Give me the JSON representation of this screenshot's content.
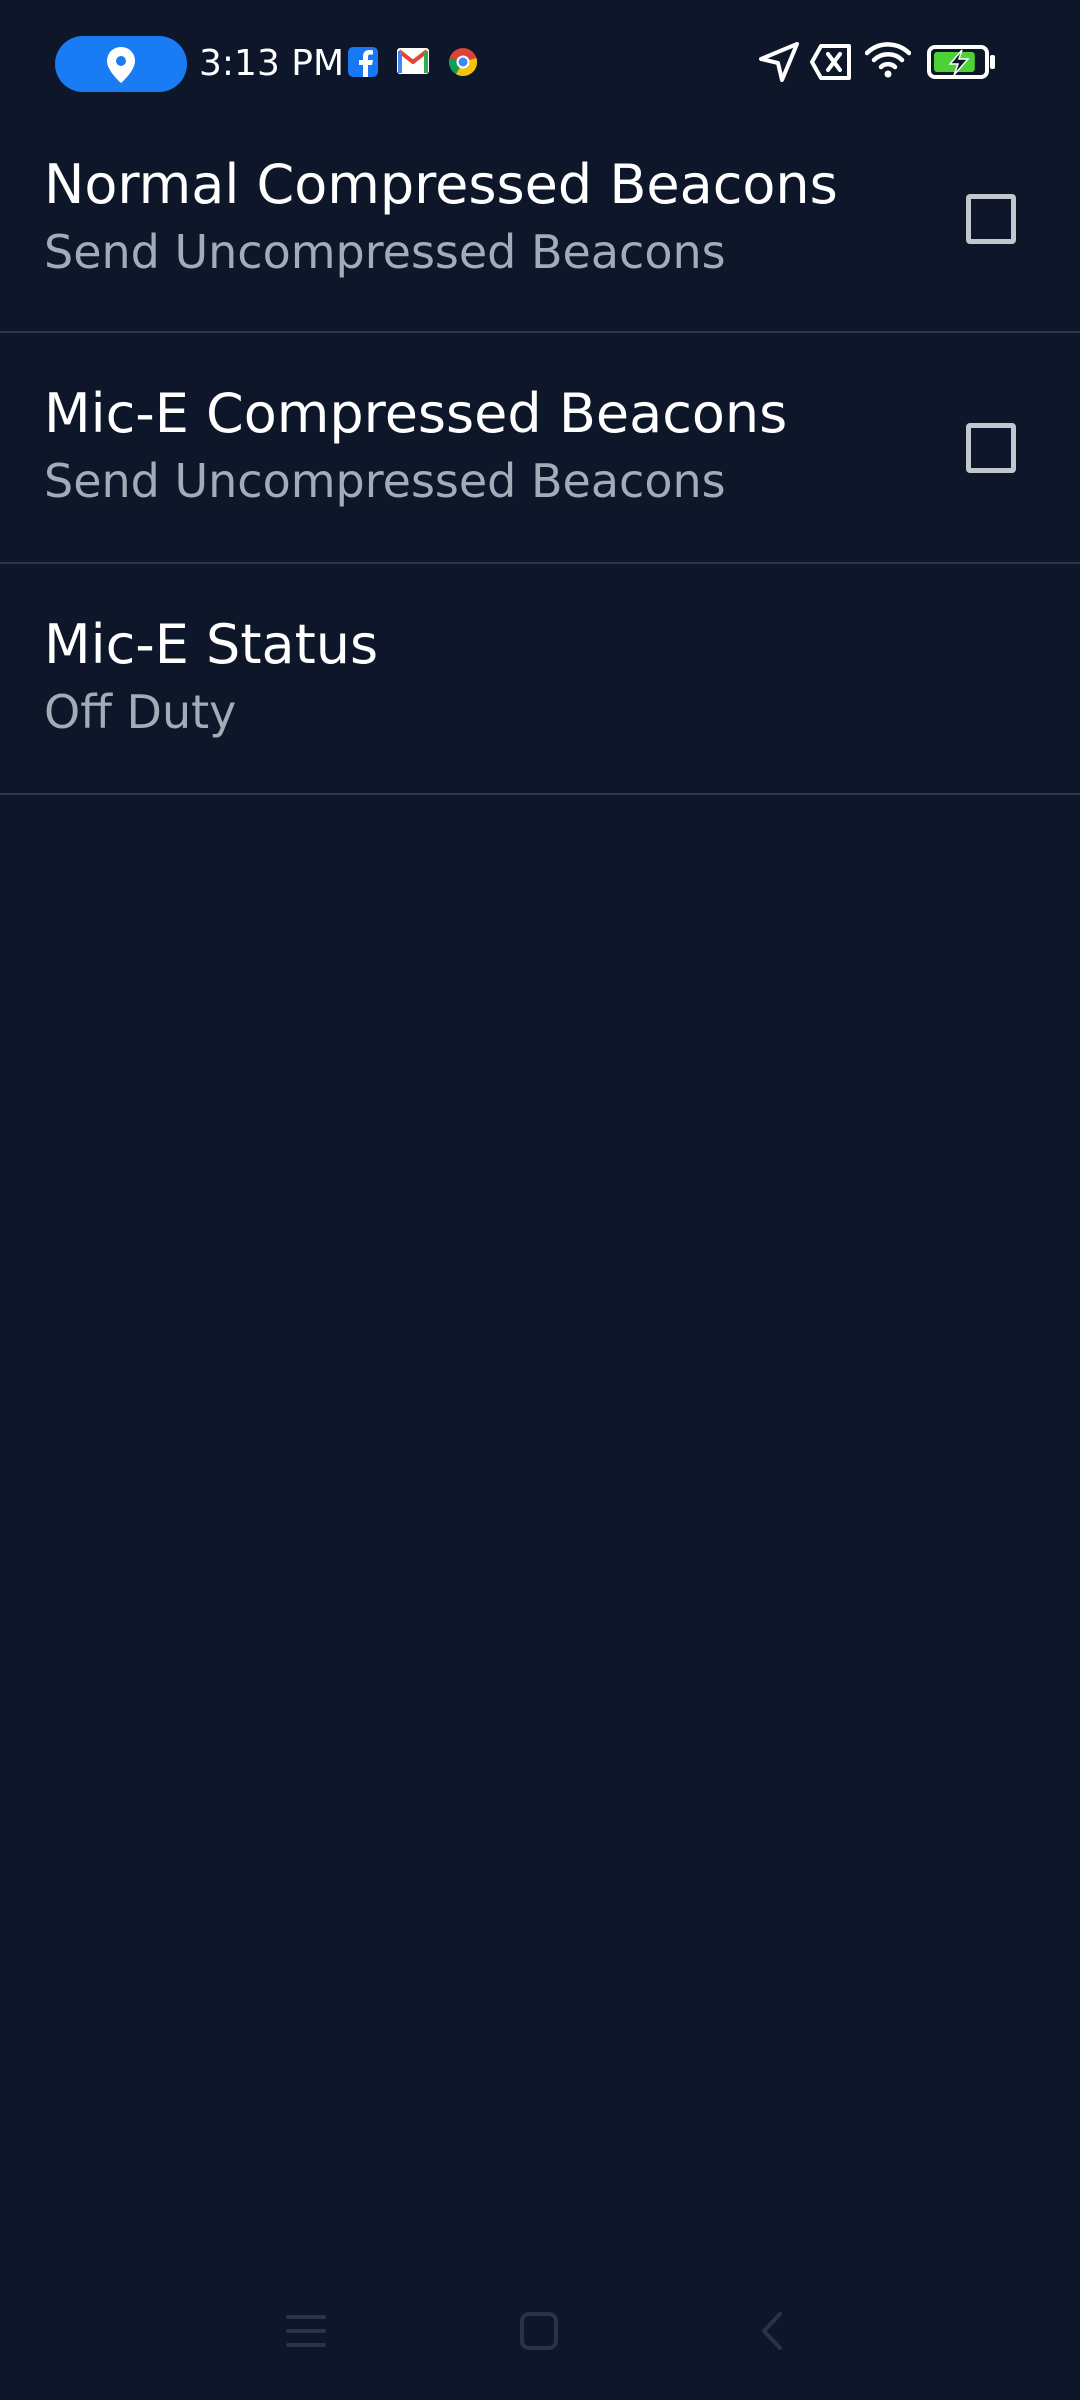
{
  "status_bar": {
    "time": "3:13 PM",
    "icons_left": [
      "location-pin-icon",
      "facebook-icon",
      "gmail-icon",
      "chrome-icon"
    ],
    "icons_right": [
      "navigation-arrow-icon",
      "no-sim-icon",
      "wifi-icon",
      "battery-charging-icon"
    ],
    "battery_fill": 0.85,
    "colors": {
      "pill": "#1a7cf5",
      "battery_fill": "#4cd137"
    }
  },
  "preferences": [
    {
      "title": "Normal Compressed Beacons",
      "summary": "Send Uncompressed Beacons",
      "has_checkbox": true,
      "checked": false
    },
    {
      "title": "Mic-E Compressed Beacons",
      "summary": "Send Uncompressed Beacons",
      "has_checkbox": true,
      "checked": false
    },
    {
      "title": "Mic-E Status",
      "summary": "Off Duty",
      "has_checkbox": false
    }
  ],
  "nav_bar": {
    "buttons": [
      "menu-icon",
      "home-square-icon",
      "back-chevron-icon"
    ]
  },
  "theme": {
    "background": "#0e172a",
    "divider": "#2d3648",
    "title_color": "#ffffff",
    "summary_color": "#a4abb7"
  }
}
